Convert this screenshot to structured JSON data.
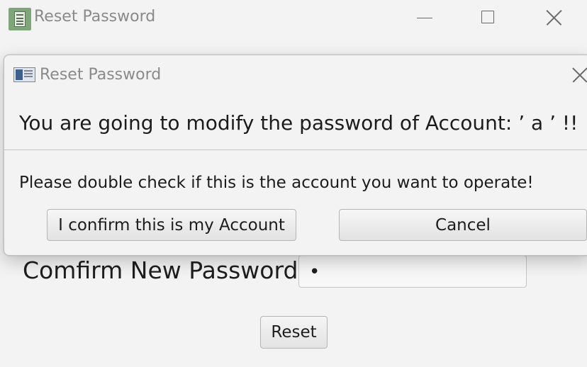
{
  "window": {
    "title": "Reset Password",
    "app_icon": "calculator-icon",
    "controls": [
      "minimize-icon",
      "maximize-icon",
      "close-icon"
    ]
  },
  "form": {
    "confirm_password_label": "Comfirm New Password:",
    "confirm_password_value": "•",
    "reset_label": "Reset"
  },
  "dialog": {
    "title": "Reset Password",
    "icon": "dialog-window-icon",
    "header": "You are going to modify the password of Account: ’ a ’ !!",
    "content": "Please double check if this is the account you want to operate!",
    "confirm_label": "I confirm this is my Account",
    "cancel_label": "Cancel"
  }
}
